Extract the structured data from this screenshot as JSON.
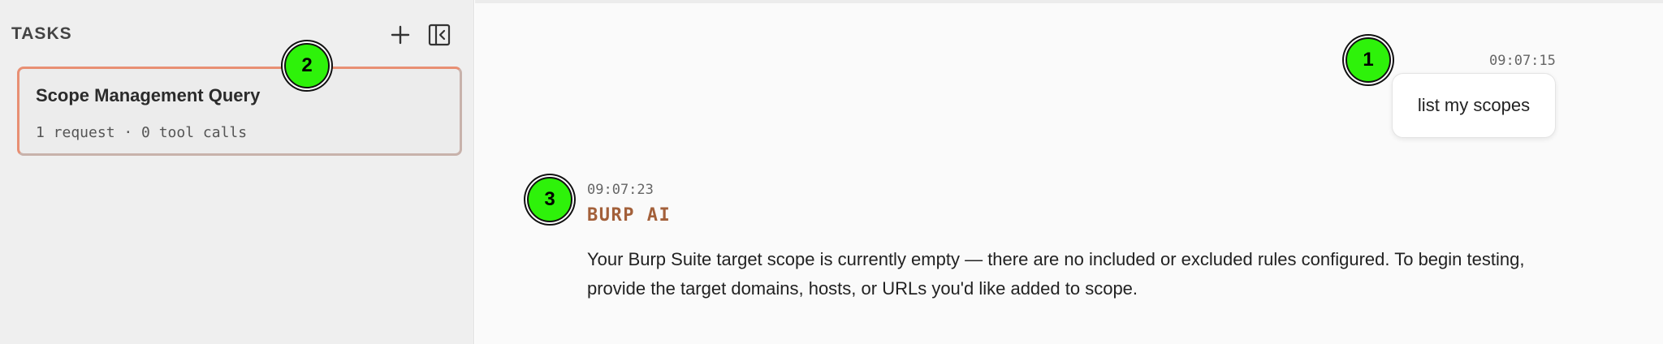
{
  "sidebar": {
    "header": "TASKS",
    "new_task_icon": "plus-icon",
    "collapse_icon": "panel-collapse-icon",
    "tasks": [
      {
        "title": "Scope Management Query",
        "meta": "1 request · 0 tool calls"
      }
    ]
  },
  "conversation": {
    "user_message": {
      "time": "09:07:15",
      "text": "list my scopes"
    },
    "agent_message": {
      "time": "09:07:23",
      "sender": "BURP AI",
      "text": "Your Burp Suite target scope is currently empty — there are no included or excluded rules configured. To begin testing, provide the target domains, hosts, or URLs you'd like added to scope."
    }
  },
  "markers": [
    "1",
    "2",
    "3"
  ],
  "colors": {
    "accent_border": "#e88f73",
    "agent_name": "#a3603a",
    "marker": "#2ef20a"
  }
}
